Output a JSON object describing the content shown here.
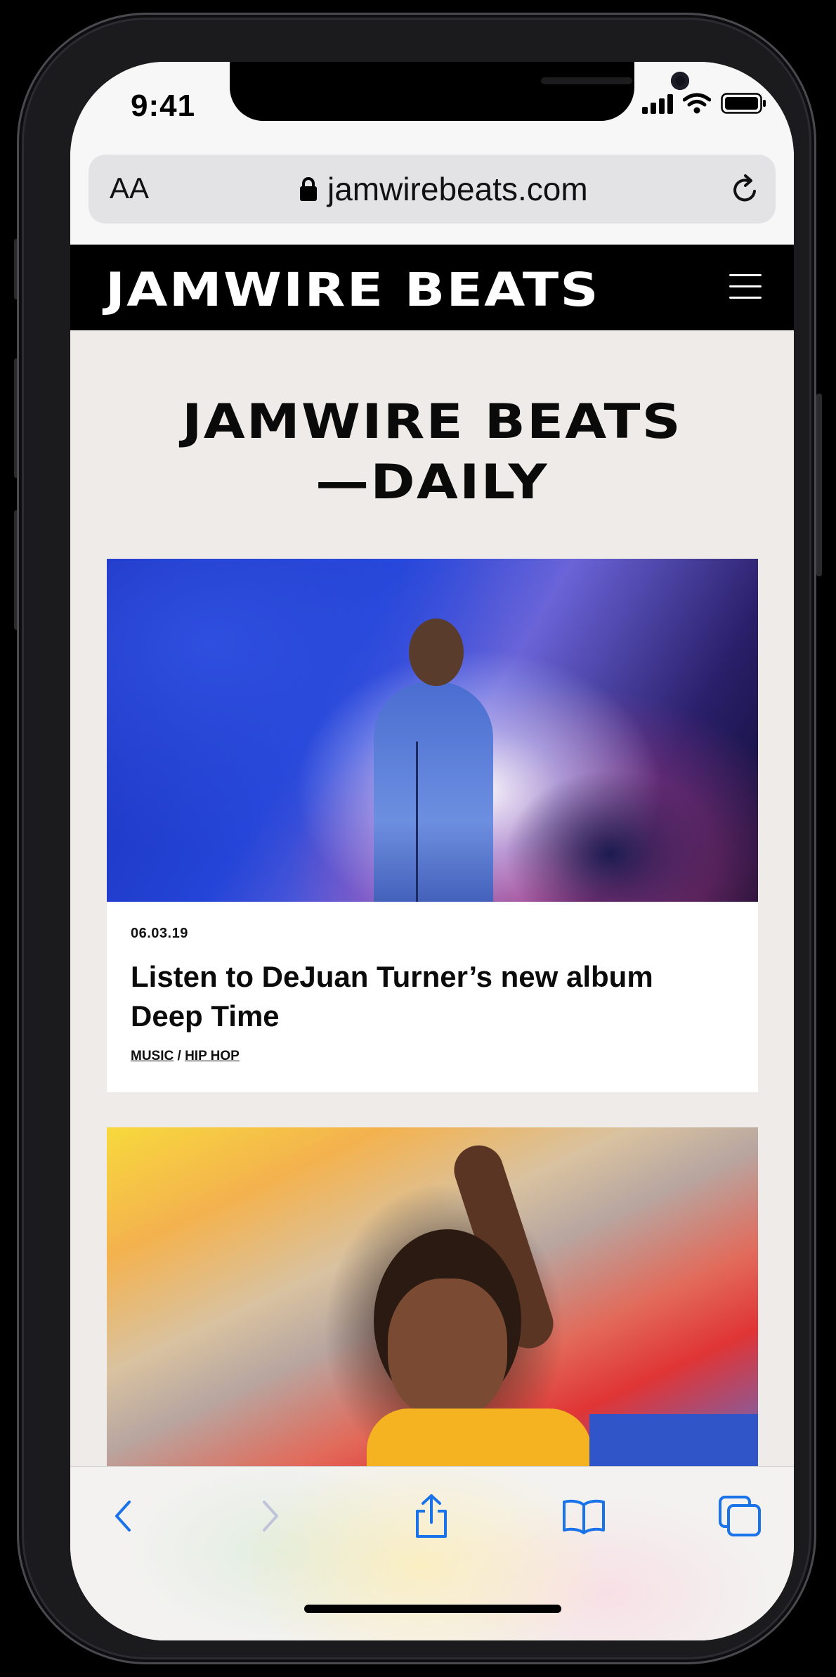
{
  "status_bar": {
    "time": "9:41"
  },
  "url_bar": {
    "text_size_label": "AA",
    "url": "jamwirebeats.com"
  },
  "site_header": {
    "logo": "JAMWIRE BEATS"
  },
  "page": {
    "title_line1": "JAMWIRE BEATS",
    "title_line2": "—DAILY"
  },
  "articles": [
    {
      "date": "06.03.19",
      "headline_line1": "Listen to DeJuan Turner’s new album",
      "headline_line2": "Deep Time",
      "tag1": "MUSIC",
      "separator": "/",
      "tag2": "HIP HOP"
    }
  ],
  "toolbar": {
    "back_icon": "chevron-left-icon",
    "forward_icon": "chevron-right-icon",
    "share_icon": "share-icon",
    "bookmarks_icon": "book-icon",
    "tabs_icon": "tabs-icon",
    "accent_color": "#1a73e8"
  }
}
